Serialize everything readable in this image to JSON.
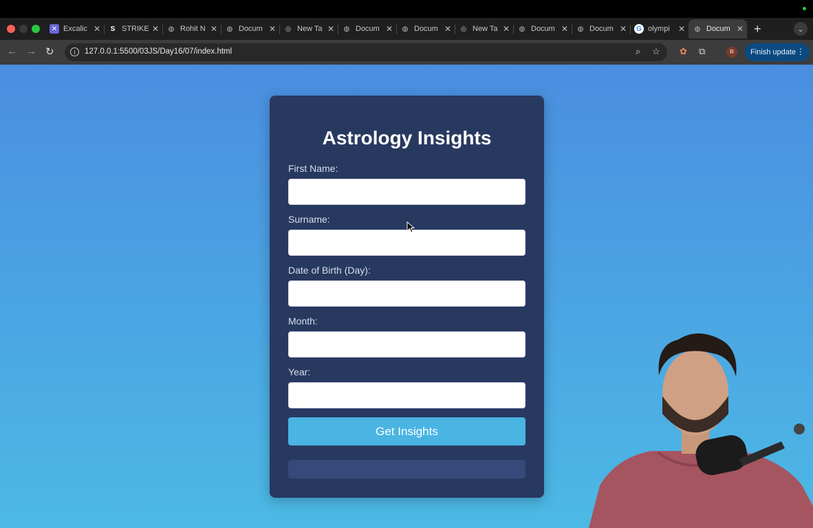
{
  "browser": {
    "tabs": [
      {
        "title": "Excalic",
        "icon": "excalidraw-icon"
      },
      {
        "title": "STRIKE",
        "icon": "strike-icon"
      },
      {
        "title": "Rohit N",
        "icon": "globe-icon"
      },
      {
        "title": "Docum",
        "icon": "globe-icon"
      },
      {
        "title": "New Ta",
        "icon": "chrome-icon"
      },
      {
        "title": "Docum",
        "icon": "globe-icon"
      },
      {
        "title": "Docum",
        "icon": "globe-icon"
      },
      {
        "title": "New Ta",
        "icon": "chrome-icon"
      },
      {
        "title": "Docum",
        "icon": "globe-icon"
      },
      {
        "title": "Docum",
        "icon": "globe-icon"
      },
      {
        "title": "olympi",
        "icon": "google-icon"
      },
      {
        "title": "Docum",
        "icon": "globe-icon",
        "active": true
      }
    ],
    "url": "127.0.0.1:5500/03JS/Day16/07/index.html",
    "profile_initial": "R",
    "finish_update_label": "Finish update"
  },
  "form": {
    "title": "Astrology Insights",
    "fields": [
      {
        "label": "First Name:",
        "value": ""
      },
      {
        "label": "Surname:",
        "value": ""
      },
      {
        "label": "Date of Birth (Day):",
        "value": ""
      },
      {
        "label": "Month:",
        "value": ""
      },
      {
        "label": "Year:",
        "value": ""
      }
    ],
    "submit_label": "Get Insights",
    "result_text": ""
  },
  "colors": {
    "background_top": "#4a8ee0",
    "background_bottom": "#4cb9e5",
    "card": "#283960",
    "button": "#4ab4e2"
  }
}
